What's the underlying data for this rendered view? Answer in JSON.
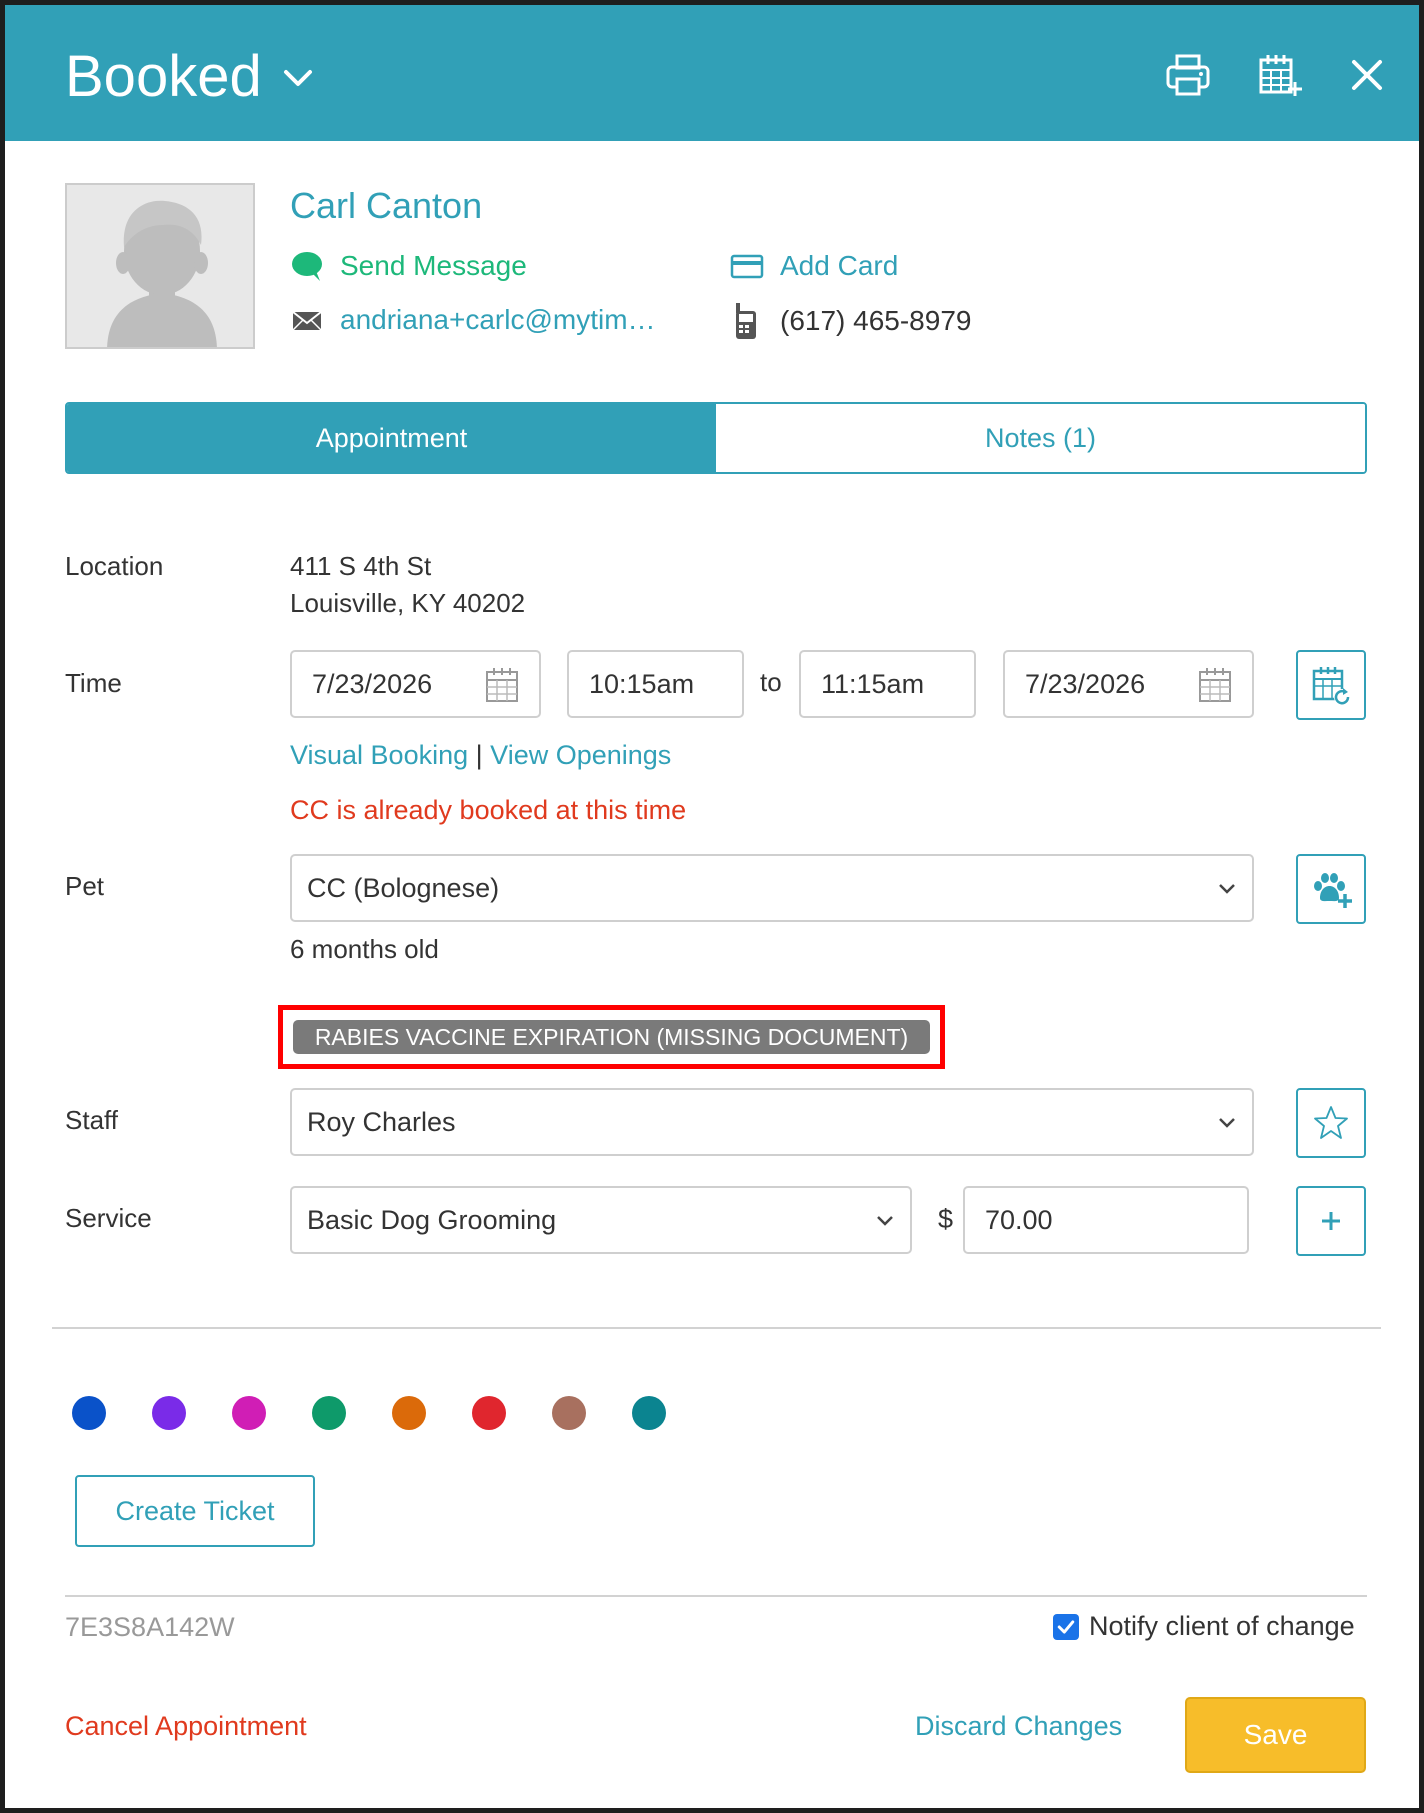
{
  "header": {
    "title": "Booked",
    "background": "#31a0b7"
  },
  "client": {
    "name": "Carl Canton",
    "send_message": "Send Message",
    "email": "andriana+carlc@mytim…",
    "add_card": "Add Card",
    "phone": "(617) 465-8979"
  },
  "tabs": {
    "appointment": "Appointment",
    "notes": "Notes (1)"
  },
  "location": {
    "label": "Location",
    "line1": "411 S 4th St",
    "line2": "Louisville, KY 40202"
  },
  "time": {
    "label": "Time",
    "start_date": "7/23/2026",
    "start_time": "10:15am",
    "to": "to",
    "end_time": "11:15am",
    "end_date": "7/23/2026",
    "visual_booking": "Visual Booking",
    "separator": "|",
    "view_openings": "View Openings",
    "warning": "CC is already booked at this time"
  },
  "pet": {
    "label": "Pet",
    "selected": "CC (Bolognese)",
    "age": "6 months old",
    "badge": "RABIES VACCINE EXPIRATION (MISSING DOCUMENT)"
  },
  "staff": {
    "label": "Staff",
    "selected": "Roy Charles"
  },
  "service": {
    "label": "Service",
    "selected": "Basic Dog Grooming",
    "currency": "$",
    "price": "70.00"
  },
  "colors": [
    "#0a52c9",
    "#7a2be8",
    "#d01eb5",
    "#0e9a6a",
    "#db6a0a",
    "#e0262e",
    "#a8705f",
    "#0b8490"
  ],
  "footer": {
    "create_ticket": "Create Ticket",
    "ticket_id": "7E3S8A142W",
    "notify_label": "Notify client of change",
    "notify_checked": true,
    "cancel": "Cancel Appointment",
    "discard": "Discard Changes",
    "save": "Save"
  }
}
